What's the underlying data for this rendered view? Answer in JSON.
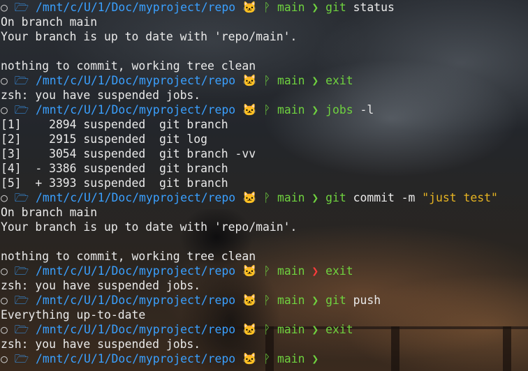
{
  "prompt": {
    "status_icon": "○",
    "folder_icon": "🗁",
    "path": "/mnt/c/U/1/Doc/myproject/repo",
    "git_icon": "🐱",
    "branch_icon": "ᚹ",
    "branch": "main",
    "arrow": "❯"
  },
  "colors": {
    "path": "#3aa0ff",
    "branch": "#6fd23f",
    "command": "#6fd23f",
    "string": "#e6b422",
    "error_arrow": "#ff3b3b",
    "text": "#eaeaea"
  },
  "lines": [
    {
      "type": "prompt",
      "cmd": "git",
      "args": " status",
      "str": "",
      "error": false
    },
    {
      "type": "out",
      "text": "On branch main"
    },
    {
      "type": "out",
      "text": "Your branch is up to date with 'repo/main'."
    },
    {
      "type": "out",
      "text": ""
    },
    {
      "type": "out",
      "text": "nothing to commit, working tree clean"
    },
    {
      "type": "prompt",
      "cmd": "exit",
      "args": "",
      "str": "",
      "error": false
    },
    {
      "type": "out",
      "text": "zsh: you have suspended jobs."
    },
    {
      "type": "prompt",
      "cmd": "jobs",
      "args": " -l",
      "str": "",
      "error": false
    },
    {
      "type": "out",
      "text": "[1]    2894 suspended  git branch"
    },
    {
      "type": "out",
      "text": "[2]    2915 suspended  git log"
    },
    {
      "type": "out",
      "text": "[3]    3054 suspended  git branch -vv"
    },
    {
      "type": "out",
      "text": "[4]  - 3386 suspended  git branch"
    },
    {
      "type": "out",
      "text": "[5]  + 3393 suspended  git branch"
    },
    {
      "type": "prompt",
      "cmd": "git",
      "args": " commit -m ",
      "str": "\"just test\"",
      "error": false
    },
    {
      "type": "out",
      "text": "On branch main"
    },
    {
      "type": "out",
      "text": "Your branch is up to date with 'repo/main'."
    },
    {
      "type": "out",
      "text": ""
    },
    {
      "type": "out",
      "text": "nothing to commit, working tree clean"
    },
    {
      "type": "prompt",
      "cmd": "exit",
      "args": "",
      "str": "",
      "error": true
    },
    {
      "type": "out",
      "text": "zsh: you have suspended jobs."
    },
    {
      "type": "prompt",
      "cmd": "git",
      "args": " push",
      "str": "",
      "error": false
    },
    {
      "type": "out",
      "text": "Everything up-to-date"
    },
    {
      "type": "prompt",
      "cmd": "exit",
      "args": "",
      "str": "",
      "error": false
    },
    {
      "type": "out",
      "text": "zsh: you have suspended jobs."
    },
    {
      "type": "prompt",
      "cmd": "",
      "args": "",
      "str": "",
      "error": false
    }
  ]
}
